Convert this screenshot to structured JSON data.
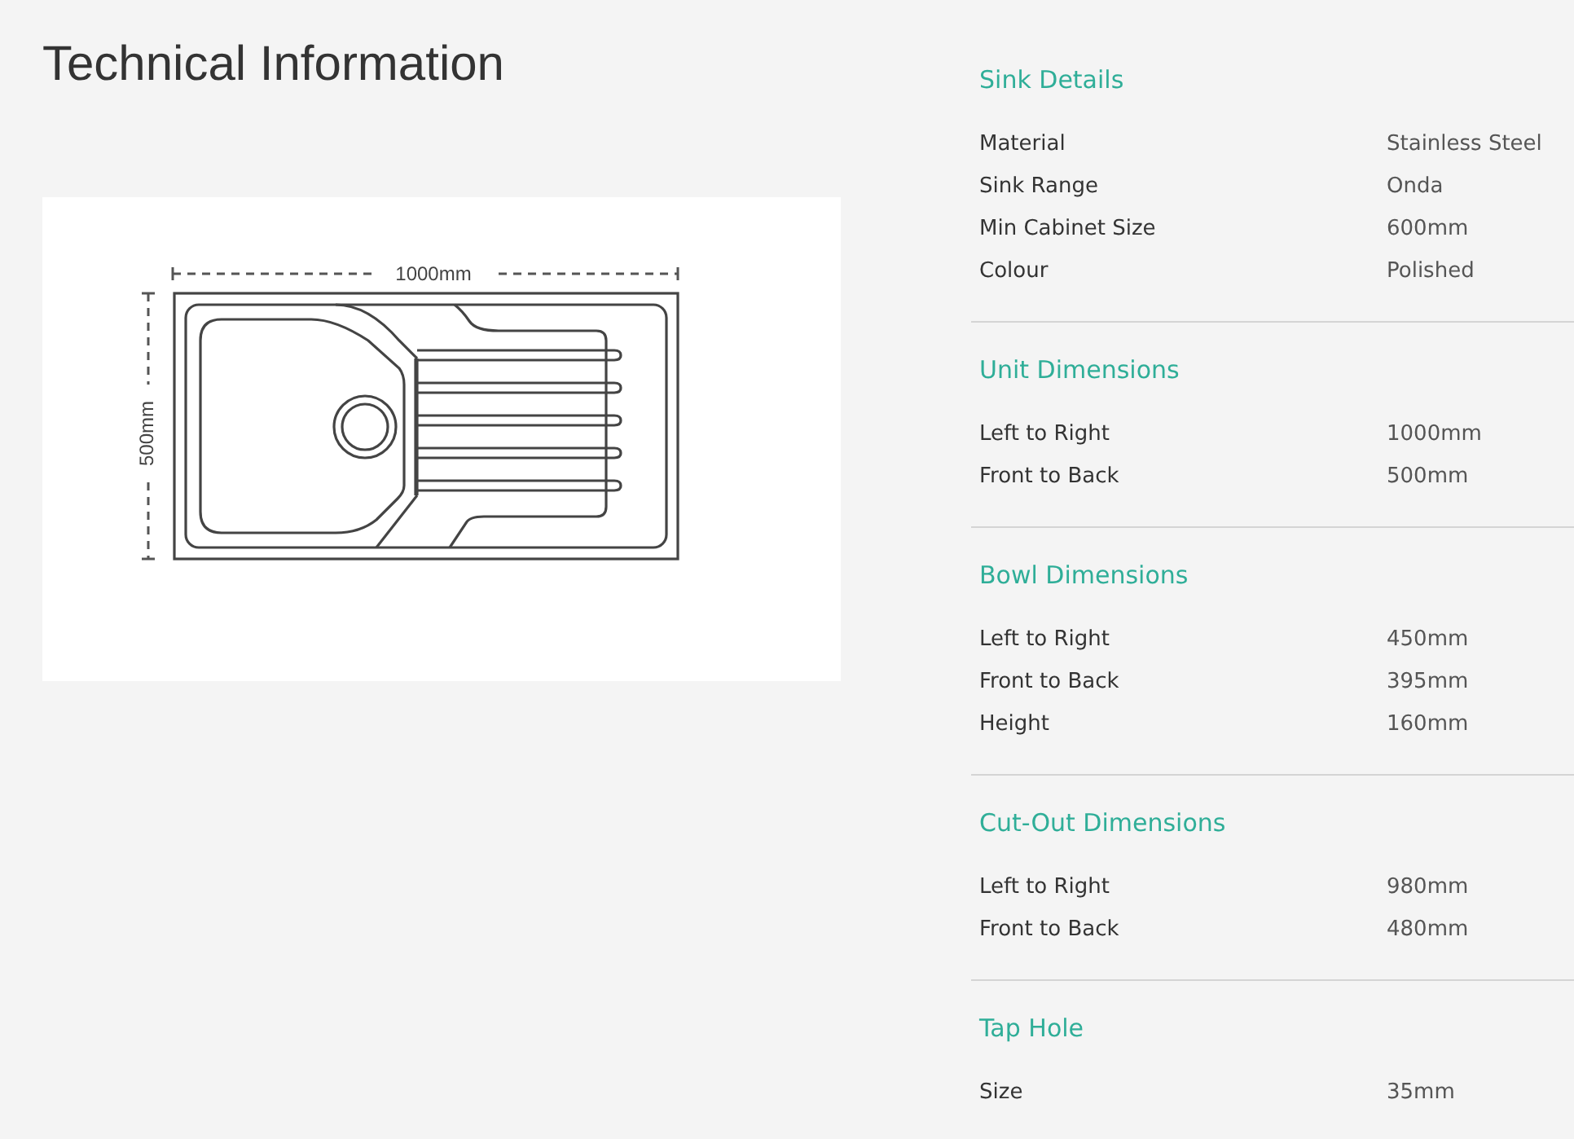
{
  "title": "Technical Information",
  "diagram": {
    "width_label": "1000mm",
    "height_label": "500mm"
  },
  "sections": [
    {
      "heading": "Sink Details",
      "rows": [
        {
          "label": "Material",
          "value": "Stainless Steel"
        },
        {
          "label": "Sink Range",
          "value": "Onda"
        },
        {
          "label": "Min Cabinet Size",
          "value": "600mm"
        },
        {
          "label": "Colour",
          "value": "Polished"
        }
      ]
    },
    {
      "heading": "Unit Dimensions",
      "rows": [
        {
          "label": "Left to Right",
          "value": "1000mm"
        },
        {
          "label": "Front to Back",
          "value": "500mm"
        }
      ]
    },
    {
      "heading": "Bowl Dimensions",
      "rows": [
        {
          "label": "Left to Right",
          "value": "450mm"
        },
        {
          "label": "Front to Back",
          "value": "395mm"
        },
        {
          "label": "Height",
          "value": "160mm"
        }
      ]
    },
    {
      "heading": "Cut-Out Dimensions",
      "rows": [
        {
          "label": "Left to Right",
          "value": "980mm"
        },
        {
          "label": "Front to Back",
          "value": "480mm"
        }
      ]
    },
    {
      "heading": "Tap Hole",
      "rows": [
        {
          "label": "Size",
          "value": "35mm"
        }
      ]
    }
  ]
}
